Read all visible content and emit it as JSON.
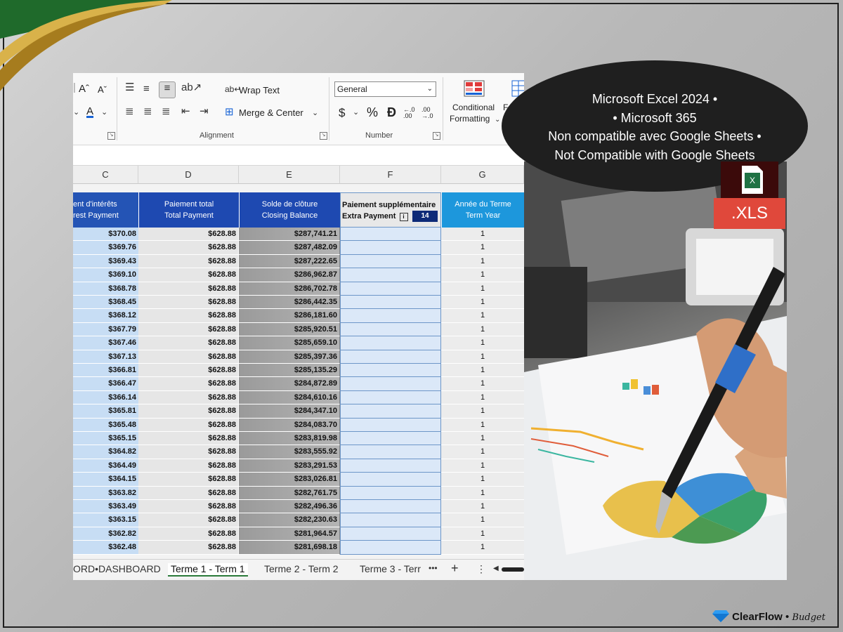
{
  "ribbon": {
    "wrap_text": "Wrap Text",
    "merge_center": "Merge & Center",
    "alignment_label": "Alignment",
    "number_format_value": "General",
    "currency_symbol": "$",
    "percent_symbol": "%",
    "comma_symbol": "Ɖ",
    "increase_decimal": "←.0 .00",
    "decrease_decimal": ".00 →.0",
    "number_label": "Number",
    "conditional_formatting_line1": "Conditional",
    "conditional_formatting_line2": "Formatting",
    "format_as_table_partial": "F",
    "font_grow": "Aˆ",
    "font_shrink": "Aˇ"
  },
  "columns": [
    "C",
    "D",
    "E",
    "F",
    "G"
  ],
  "headers": {
    "C": {
      "fr": "ent d'intérêts",
      "en": "rest Payment",
      "color": "#2454b5"
    },
    "D": {
      "fr": "Paiement total",
      "en": "Total Payment",
      "color": "#1e49b1"
    },
    "E": {
      "fr": "Solde de clôture",
      "en": "Closing Balance",
      "color": "#1e49b1"
    },
    "F": {
      "fr": "Paiement supplémentaire",
      "en": "Extra Payment",
      "badge": "14"
    },
    "G": {
      "fr": "Année du Terme",
      "en": "Term Year",
      "color": "#1d97dc"
    }
  },
  "rows": [
    {
      "interest": "$370.08",
      "total": "$628.88",
      "balance": "$287,741.21",
      "year": "1"
    },
    {
      "interest": "$369.76",
      "total": "$628.88",
      "balance": "$287,482.09",
      "year": "1"
    },
    {
      "interest": "$369.43",
      "total": "$628.88",
      "balance": "$287,222.65",
      "year": "1"
    },
    {
      "interest": "$369.10",
      "total": "$628.88",
      "balance": "$286,962.87",
      "year": "1"
    },
    {
      "interest": "$368.78",
      "total": "$628.88",
      "balance": "$286,702.78",
      "year": "1"
    },
    {
      "interest": "$368.45",
      "total": "$628.88",
      "balance": "$286,442.35",
      "year": "1"
    },
    {
      "interest": "$368.12",
      "total": "$628.88",
      "balance": "$286,181.60",
      "year": "1"
    },
    {
      "interest": "$367.79",
      "total": "$628.88",
      "balance": "$285,920.51",
      "year": "1"
    },
    {
      "interest": "$367.46",
      "total": "$628.88",
      "balance": "$285,659.10",
      "year": "1"
    },
    {
      "interest": "$367.13",
      "total": "$628.88",
      "balance": "$285,397.36",
      "year": "1"
    },
    {
      "interest": "$366.81",
      "total": "$628.88",
      "balance": "$285,135.29",
      "year": "1"
    },
    {
      "interest": "$366.47",
      "total": "$628.88",
      "balance": "$284,872.89",
      "year": "1"
    },
    {
      "interest": "$366.14",
      "total": "$628.88",
      "balance": "$284,610.16",
      "year": "1"
    },
    {
      "interest": "$365.81",
      "total": "$628.88",
      "balance": "$284,347.10",
      "year": "1"
    },
    {
      "interest": "$365.48",
      "total": "$628.88",
      "balance": "$284,083.70",
      "year": "1"
    },
    {
      "interest": "$365.15",
      "total": "$628.88",
      "balance": "$283,819.98",
      "year": "1"
    },
    {
      "interest": "$364.82",
      "total": "$628.88",
      "balance": "$283,555.92",
      "year": "1"
    },
    {
      "interest": "$364.49",
      "total": "$628.88",
      "balance": "$283,291.53",
      "year": "1"
    },
    {
      "interest": "$364.15",
      "total": "$628.88",
      "balance": "$283,026.81",
      "year": "1"
    },
    {
      "interest": "$363.82",
      "total": "$628.88",
      "balance": "$282,761.75",
      "year": "1"
    },
    {
      "interest": "$363.49",
      "total": "$628.88",
      "balance": "$282,496.36",
      "year": "1"
    },
    {
      "interest": "$363.15",
      "total": "$628.88",
      "balance": "$282,230.63",
      "year": "1"
    },
    {
      "interest": "$362.82",
      "total": "$628.88",
      "balance": "$281,964.57",
      "year": "1"
    },
    {
      "interest": "$362.48",
      "total": "$628.88",
      "balance": "$281,698.18",
      "year": "1"
    }
  ],
  "tabs": {
    "dashboard": "ORD•DASHBOARD",
    "term1": "Terme 1 - Term 1",
    "term2": "Terme 2 - Term 2",
    "term3": "Terme 3 - Terr",
    "more": "•••",
    "add": "+",
    "options": "⋮"
  },
  "bubble": {
    "line1": "Microsoft Excel 2024 •",
    "line2": "• Microsoft 365",
    "line3": "Non compatible avec Google Sheets •",
    "line4": "Not Compatible with Google Sheets"
  },
  "xls_badge": ".XLS",
  "brand": {
    "name": "ClearFlow",
    "sep": " • ",
    "product": "Budget"
  }
}
